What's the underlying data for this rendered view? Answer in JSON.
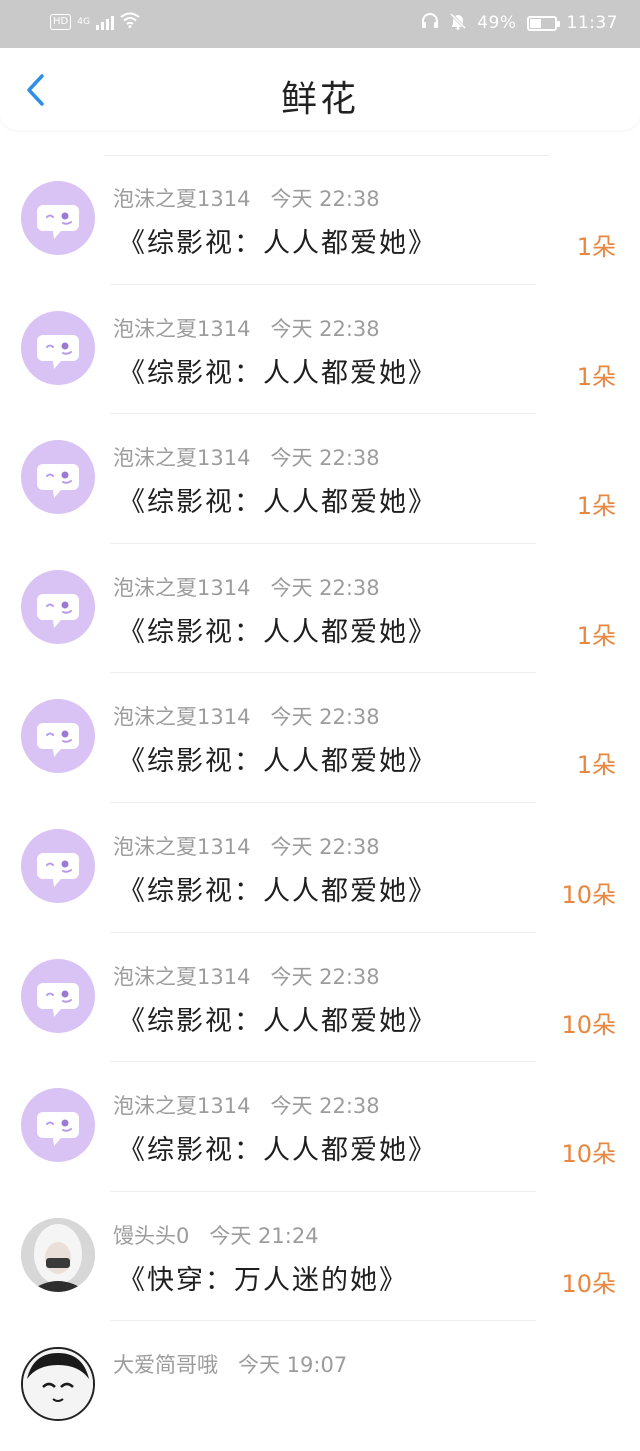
{
  "status_bar": {
    "hd": "HD",
    "signal": "4G",
    "battery_percent": "49%",
    "battery_level": 0.49,
    "time": "11:37",
    "icons": [
      "headset-icon",
      "mute-bell-icon",
      "wifi-icon",
      "battery-icon"
    ]
  },
  "header": {
    "title": "鲜花",
    "back_icon": "chevron-left-icon"
  },
  "colors": {
    "accent_blue": "#2f8fe6",
    "amount_orange": "#e8873f",
    "avatar_purple": "#d9c2f4"
  },
  "rows": [
    {
      "user": "泡沫之夏1314",
      "time": "今天 22:38",
      "book": "《综影视：人人都爱她》",
      "amount": "1朵",
      "avatar": "chat-bubble-icon"
    },
    {
      "user": "泡沫之夏1314",
      "time": "今天 22:38",
      "book": "《综影视：人人都爱她》",
      "amount": "1朵",
      "avatar": "chat-bubble-icon"
    },
    {
      "user": "泡沫之夏1314",
      "time": "今天 22:38",
      "book": "《综影视：人人都爱她》",
      "amount": "1朵",
      "avatar": "chat-bubble-icon"
    },
    {
      "user": "泡沫之夏1314",
      "time": "今天 22:38",
      "book": "《综影视：人人都爱她》",
      "amount": "1朵",
      "avatar": "chat-bubble-icon"
    },
    {
      "user": "泡沫之夏1314",
      "time": "今天 22:38",
      "book": "《综影视：人人都爱她》",
      "amount": "1朵",
      "avatar": "chat-bubble-icon"
    },
    {
      "user": "泡沫之夏1314",
      "time": "今天 22:38",
      "book": "《综影视：人人都爱她》",
      "amount": "10朵",
      "avatar": "chat-bubble-icon"
    },
    {
      "user": "泡沫之夏1314",
      "time": "今天 22:38",
      "book": "《综影视：人人都爱她》",
      "amount": "10朵",
      "avatar": "chat-bubble-icon"
    },
    {
      "user": "泡沫之夏1314",
      "time": "今天 22:38",
      "book": "《综影视：人人都爱她》",
      "amount": "10朵",
      "avatar": "chat-bubble-icon"
    },
    {
      "user": "馒头头0",
      "time": "今天 21:24",
      "book": "《快穿：万人迷的她》",
      "amount": "10朵",
      "avatar": "user-photo"
    },
    {
      "user": "大爱简哥哦",
      "time": "今天 19:07",
      "book": "",
      "amount": "",
      "avatar": "manga-avatar"
    }
  ]
}
